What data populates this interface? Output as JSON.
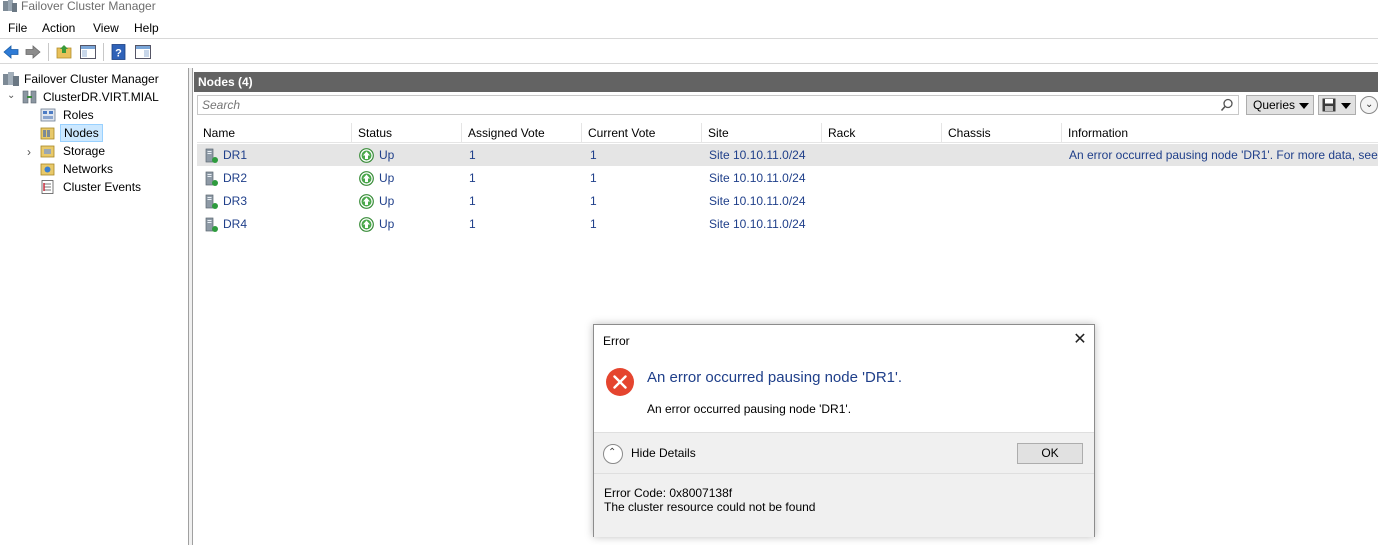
{
  "window": {
    "title": "Failover Cluster Manager"
  },
  "menu": [
    "File",
    "Action",
    "View",
    "Help"
  ],
  "toolbar": {
    "icons": [
      "back-arrow-icon",
      "forward-arrow-icon",
      "up-folder-icon",
      "show-hide-tree-icon",
      "help-icon",
      "action-pane-icon"
    ]
  },
  "tree": {
    "root": "Failover Cluster Manager",
    "cluster": "ClusterDR.VIRT.MIAL",
    "items": [
      {
        "label": "Roles",
        "icon": "roles-icon"
      },
      {
        "label": "Nodes",
        "icon": "nodes-icon",
        "selected": true
      },
      {
        "label": "Storage",
        "icon": "storage-icon",
        "expandable": true
      },
      {
        "label": "Networks",
        "icon": "networks-icon"
      },
      {
        "label": "Cluster Events",
        "icon": "cluster-events-icon"
      }
    ]
  },
  "main": {
    "header": "Nodes (4)",
    "search_placeholder": "Search",
    "queries_label": "Queries",
    "columns": [
      "Name",
      "Status",
      "Assigned Vote",
      "Current Vote",
      "Site",
      "Rack",
      "Chassis",
      "Information"
    ],
    "rows": [
      {
        "name": "DR1",
        "status": "Up",
        "assigned_vote": "1",
        "current_vote": "1",
        "site": "Site 10.10.11.0/24",
        "rack": "",
        "chassis": "",
        "information": "An error occurred pausing node 'DR1'. For more data, see '"
      },
      {
        "name": "DR2",
        "status": "Up",
        "assigned_vote": "1",
        "current_vote": "1",
        "site": "Site 10.10.11.0/24",
        "rack": "",
        "chassis": "",
        "information": ""
      },
      {
        "name": "DR3",
        "status": "Up",
        "assigned_vote": "1",
        "current_vote": "1",
        "site": "Site 10.10.11.0/24",
        "rack": "",
        "chassis": "",
        "information": ""
      },
      {
        "name": "DR4",
        "status": "Up",
        "assigned_vote": "1",
        "current_vote": "1",
        "site": "Site 10.10.11.0/24",
        "rack": "",
        "chassis": "",
        "information": ""
      }
    ]
  },
  "dialog": {
    "title": "Error",
    "heading": "An error occurred pausing node 'DR1'.",
    "message": "An error occurred pausing node 'DR1'.",
    "details_toggle": "Hide Details",
    "ok": "OK",
    "details": [
      "Error Code: 0x8007138f",
      "The cluster resource could not be found"
    ]
  },
  "colors": {
    "header_bg": "#636363",
    "link_text": "#1f3f8a",
    "error_red": "#e5452f",
    "selection": "#cce8ff"
  }
}
